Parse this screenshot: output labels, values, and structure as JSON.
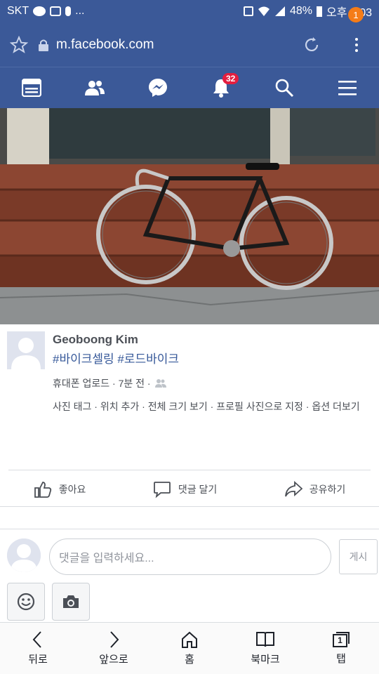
{
  "status_bar": {
    "carrier": "SKT",
    "battery": "48%",
    "time": "오후 3:03",
    "dots": "..."
  },
  "browser": {
    "url": "m.facebook.com",
    "menu_badge": "1"
  },
  "fb_nav": {
    "notifications_badge": "32",
    "items": [
      "news-feed",
      "friend-requests",
      "messenger",
      "notifications",
      "search",
      "menu"
    ]
  },
  "post": {
    "author": "Geoboong Kim",
    "caption": "#바이크셀링 #로드바이크",
    "meta": "휴대폰 업로드 · 7분 전 ·",
    "options": "사진 태그 · 위치 추가 · 전체 크기 보기 · 프로필 사진으로 지정 · 옵션 더보기",
    "actions": {
      "like": "좋아요",
      "comment": "댓글 달기",
      "share": "공유하기"
    }
  },
  "comment": {
    "placeholder": "댓글을 입력하세요...",
    "post_button": "게시"
  },
  "bottom_nav": {
    "back": "뒤로",
    "forward": "앞으로",
    "home": "홈",
    "bookmarks": "북마크",
    "tabs": "탭",
    "tab_count": "1"
  },
  "colors": {
    "brand": "#3b5998",
    "notification": "#e41e3f",
    "menu_badge": "#f57c17"
  }
}
